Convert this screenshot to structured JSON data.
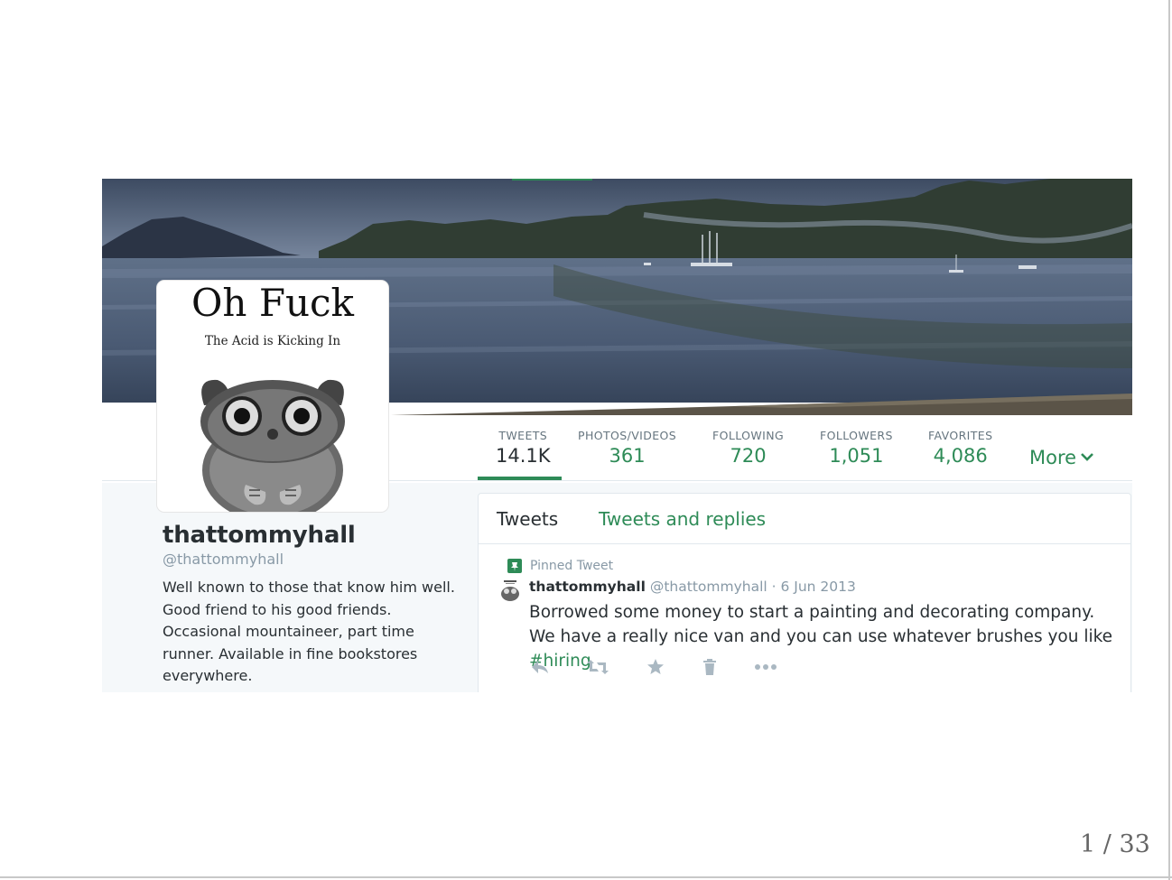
{
  "avatar": {
    "title": "Oh Fuck",
    "subtitle": "The Acid is Kicking In"
  },
  "nav": {
    "items": [
      {
        "label": "TWEETS",
        "value": "14.1K",
        "active": true
      },
      {
        "label": "PHOTOS/VIDEOS",
        "value": "361"
      },
      {
        "label": "FOLLOWING",
        "value": "720"
      },
      {
        "label": "FOLLOWERS",
        "value": "1,051"
      },
      {
        "label": "FAVORITES",
        "value": "4,086"
      }
    ],
    "more_label": "More",
    "accent_color": "#2e8b57"
  },
  "profile": {
    "name": "thattommyhall",
    "handle": "@thattommyhall",
    "bio": "Well known to those that know him well. Good friend to his good friends. Occasional mountaineer, part time runner. Available in fine bookstores everywhere."
  },
  "timeline": {
    "tabs": [
      "Tweets",
      "Tweets and replies"
    ],
    "pinned_label": "Pinned Tweet",
    "tweet": {
      "name": "thattommyhall",
      "handle": "@thattommyhall",
      "separator": "·",
      "date": "6 Jun 2013",
      "text": "Borrowed some money to start a painting and decorating company. We have a really nice van and you can use whatever brushes you like",
      "hashtag": "#hiring"
    },
    "actions": [
      "reply-icon",
      "retweet-icon",
      "favorite-icon",
      "delete-icon",
      "more-icon"
    ]
  },
  "slide": {
    "page_number": "1 / 33"
  }
}
